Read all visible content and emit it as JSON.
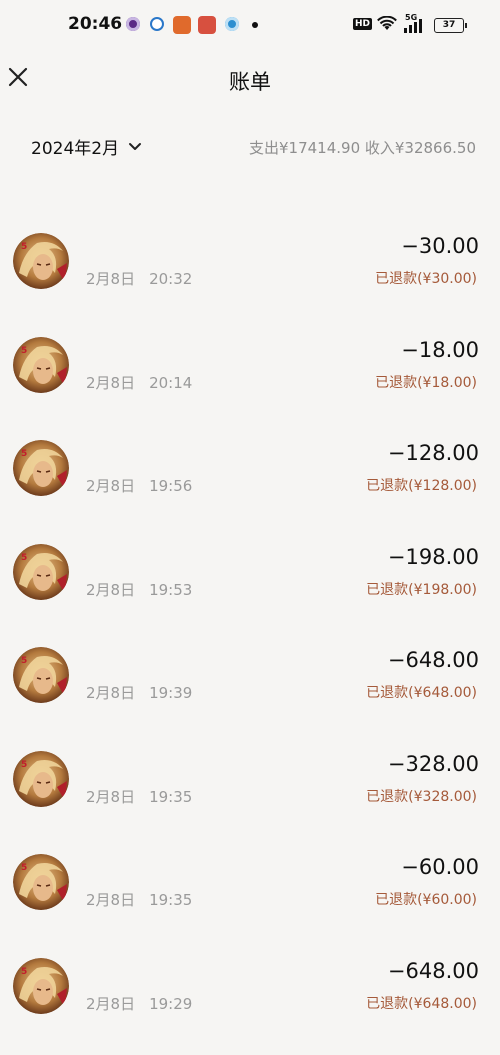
{
  "status": {
    "time": "20:46",
    "hd": "HD",
    "signal": "5G",
    "battery": "37"
  },
  "header": {
    "title": "账单"
  },
  "filter": {
    "month": "2024年2月",
    "summary": "支出¥17414.90 收入¥32866.50"
  },
  "transactions": [
    {
      "date": "2月8日",
      "time": "20:32",
      "amount": "−30.00",
      "status": "已退款(¥30.00)"
    },
    {
      "date": "2月8日",
      "time": "20:14",
      "amount": "−18.00",
      "status": "已退款(¥18.00)"
    },
    {
      "date": "2月8日",
      "time": "19:56",
      "amount": "−128.00",
      "status": "已退款(¥128.00)"
    },
    {
      "date": "2月8日",
      "time": "19:53",
      "amount": "−198.00",
      "status": "已退款(¥198.00)"
    },
    {
      "date": "2月8日",
      "time": "19:39",
      "amount": "−648.00",
      "status": "已退款(¥648.00)"
    },
    {
      "date": "2月8日",
      "time": "19:35",
      "amount": "−328.00",
      "status": "已退款(¥328.00)"
    },
    {
      "date": "2月8日",
      "time": "19:35",
      "amount": "−60.00",
      "status": "已退款(¥60.00)"
    },
    {
      "date": "2月8日",
      "time": "19:29",
      "amount": "−648.00",
      "status": "已退款(¥648.00)"
    }
  ],
  "colors": {
    "background": "#f6f5f3",
    "refund_text": "#a55a3a",
    "secondary_text": "#9a9a9a"
  }
}
